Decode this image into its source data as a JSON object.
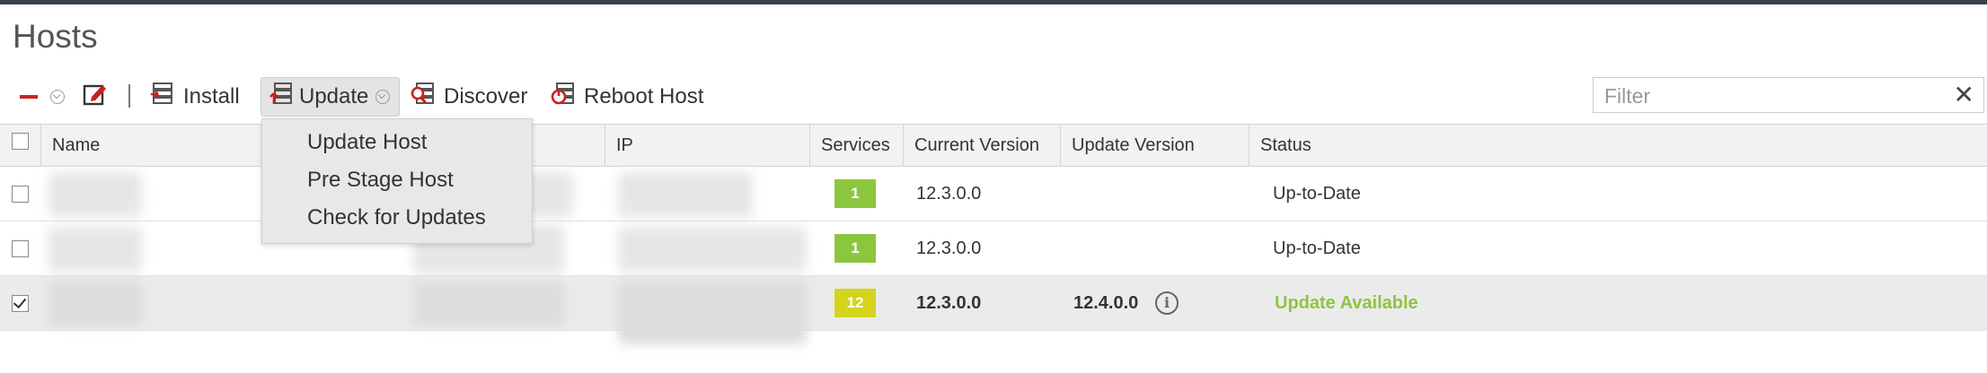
{
  "page": {
    "title": "Hosts"
  },
  "toolbar": {
    "remove_icon": "minus-icon",
    "edit_icon": "edit-icon",
    "install_label": "Install",
    "update_label": "Update",
    "discover_label": "Discover",
    "reboot_label": "Reboot Host"
  },
  "update_menu": {
    "items": [
      {
        "label": "Update Host"
      },
      {
        "label": "Pre Stage Host"
      },
      {
        "label": "Check for Updates"
      }
    ]
  },
  "filter": {
    "placeholder": "Filter",
    "value": ""
  },
  "table": {
    "columns": [
      "Name",
      "IP",
      "Services",
      "Current Version",
      "Update Version",
      "Status"
    ],
    "rows": [
      {
        "checked": false,
        "services": "1",
        "services_color": "#8cc63f",
        "current_version": "12.3.0.0",
        "update_version": "",
        "status": "Up-to-Date"
      },
      {
        "checked": false,
        "services": "1",
        "services_color": "#8cc63f",
        "current_version": "12.3.0.0",
        "update_version": "",
        "status": "Up-to-Date"
      },
      {
        "checked": true,
        "services": "12",
        "services_color": "#d4d41c",
        "current_version": "12.3.0.0",
        "update_version": "12.4.0.0",
        "status": "Update Available",
        "status_color": "#8cc63f"
      }
    ]
  }
}
